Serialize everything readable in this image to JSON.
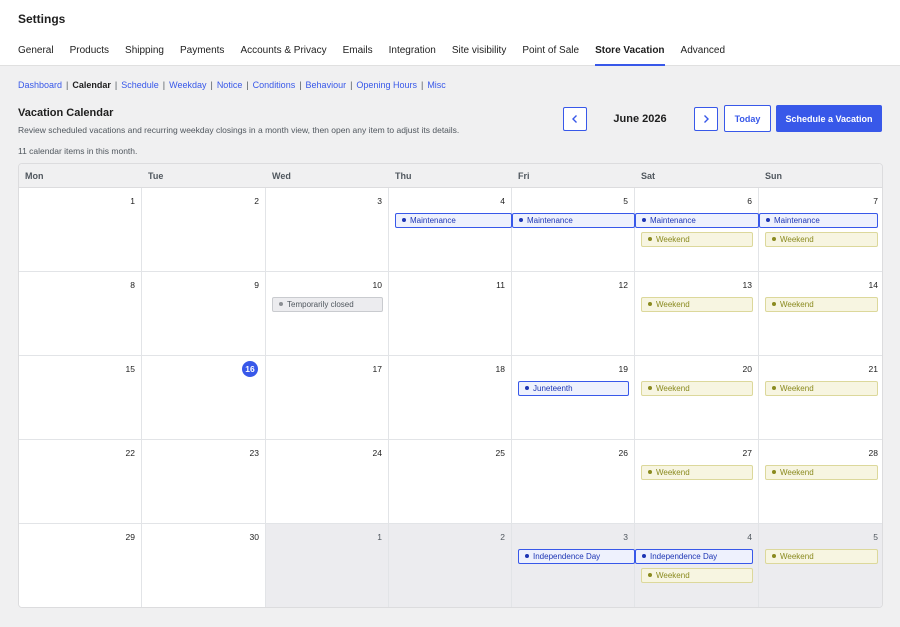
{
  "header": {
    "title": "Settings"
  },
  "tabs": [
    {
      "label": "General"
    },
    {
      "label": "Products"
    },
    {
      "label": "Shipping"
    },
    {
      "label": "Payments"
    },
    {
      "label": "Accounts & Privacy"
    },
    {
      "label": "Emails"
    },
    {
      "label": "Integration"
    },
    {
      "label": "Site visibility"
    },
    {
      "label": "Point of Sale"
    },
    {
      "label": "Store Vacation",
      "active": true
    },
    {
      "label": "Advanced"
    }
  ],
  "subnav": [
    {
      "label": "Dashboard"
    },
    {
      "label": "Calendar",
      "current": true
    },
    {
      "label": "Schedule"
    },
    {
      "label": "Weekday"
    },
    {
      "label": "Notice"
    },
    {
      "label": "Conditions"
    },
    {
      "label": "Behaviour"
    },
    {
      "label": "Opening Hours"
    },
    {
      "label": "Misc"
    }
  ],
  "calendar": {
    "title": "Vacation Calendar",
    "description": "Review scheduled vacations and recurring weekday closings in a month view, then open any item to adjust its details.",
    "count_text": "11 calendar items in this month.",
    "month_label": "June 2026",
    "today_label": "Today",
    "schedule_label": "Schedule a Vacation",
    "weekdays": [
      "Mon",
      "Tue",
      "Wed",
      "Thu",
      "Fri",
      "Sat",
      "Sun"
    ],
    "weeks": [
      [
        {
          "day": "1"
        },
        {
          "day": "2"
        },
        {
          "day": "3"
        },
        {
          "day": "4",
          "events": [
            {
              "label": "Maintenance",
              "kind": "blue",
              "span": "start"
            }
          ]
        },
        {
          "day": "5",
          "events": [
            {
              "label": "Maintenance",
              "kind": "blue",
              "span": "mid"
            }
          ]
        },
        {
          "day": "6",
          "events": [
            {
              "label": "Maintenance",
              "kind": "blue",
              "span": "mid"
            },
            {
              "label": "Weekend",
              "kind": "yellow"
            }
          ]
        },
        {
          "day": "7",
          "events": [
            {
              "label": "Maintenance",
              "kind": "blue",
              "span": "end"
            },
            {
              "label": "Weekend",
              "kind": "yellow"
            }
          ]
        }
      ],
      [
        {
          "day": "8"
        },
        {
          "day": "9"
        },
        {
          "day": "10",
          "events": [
            {
              "label": "Temporarily closed",
              "kind": "gray"
            }
          ]
        },
        {
          "day": "11"
        },
        {
          "day": "12"
        },
        {
          "day": "13",
          "events": [
            {
              "label": "Weekend",
              "kind": "yellow"
            }
          ]
        },
        {
          "day": "14",
          "events": [
            {
              "label": "Weekend",
              "kind": "yellow"
            }
          ]
        }
      ],
      [
        {
          "day": "15"
        },
        {
          "day": "16",
          "today": true
        },
        {
          "day": "17"
        },
        {
          "day": "18"
        },
        {
          "day": "19",
          "events": [
            {
              "label": "Juneteenth",
              "kind": "blue"
            }
          ]
        },
        {
          "day": "20",
          "events": [
            {
              "label": "Weekend",
              "kind": "yellow"
            }
          ]
        },
        {
          "day": "21",
          "events": [
            {
              "label": "Weekend",
              "kind": "yellow"
            }
          ]
        }
      ],
      [
        {
          "day": "22"
        },
        {
          "day": "23"
        },
        {
          "day": "24"
        },
        {
          "day": "25"
        },
        {
          "day": "26"
        },
        {
          "day": "27",
          "events": [
            {
              "label": "Weekend",
              "kind": "yellow"
            }
          ]
        },
        {
          "day": "28",
          "events": [
            {
              "label": "Weekend",
              "kind": "yellow"
            }
          ]
        }
      ],
      [
        {
          "day": "29"
        },
        {
          "day": "30"
        },
        {
          "day": "1",
          "other": true
        },
        {
          "day": "2",
          "other": true
        },
        {
          "day": "3",
          "other": true,
          "events": [
            {
              "label": "Independence Day",
              "kind": "blue",
              "span": "start"
            }
          ]
        },
        {
          "day": "4",
          "other": true,
          "events": [
            {
              "label": "Independence Day",
              "kind": "blue",
              "span": "end"
            },
            {
              "label": "Weekend",
              "kind": "yellow"
            }
          ]
        },
        {
          "day": "5",
          "other": true,
          "events": [
            {
              "label": "Weekend",
              "kind": "yellow"
            }
          ]
        }
      ]
    ]
  },
  "colors": {
    "accent": "#3858e9",
    "event_blue": "#1d35b4",
    "event_yellow": "#8a8a1f"
  },
  "icons": {
    "prev": "chevron-left-icon",
    "next": "chevron-right-icon"
  }
}
